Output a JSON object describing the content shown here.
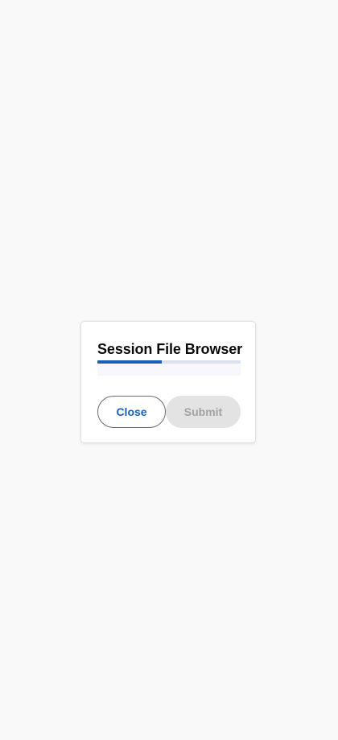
{
  "dialog": {
    "title": "Session File Browser",
    "progress_fraction": 0.45,
    "buttons": {
      "close_label": "Close",
      "submit_label": "Submit",
      "submit_disabled": true
    }
  },
  "colors": {
    "background": "#f9f9f9",
    "accent": "#1760b8",
    "progress_track": "#dde1ef",
    "disabled_bg": "#e3e3e3",
    "disabled_text": "#a2a2a2"
  }
}
